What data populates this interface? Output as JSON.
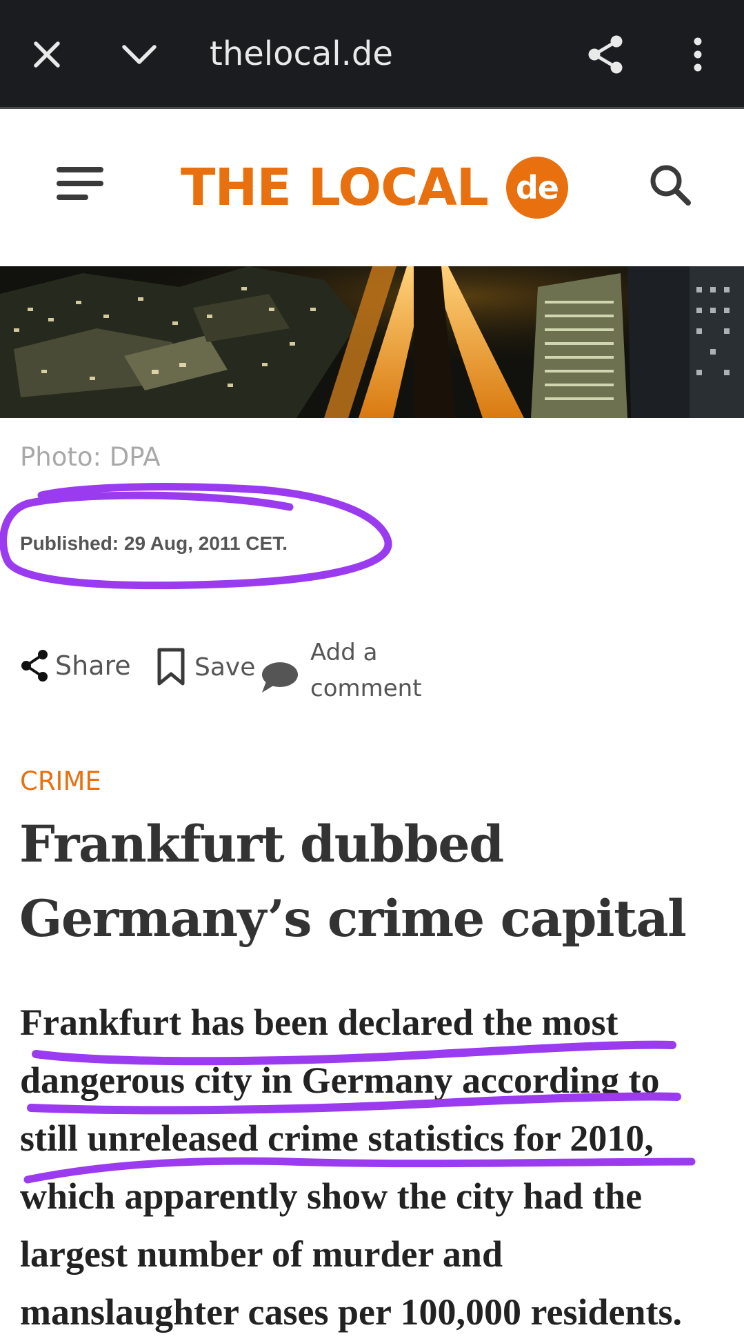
{
  "browser": {
    "url": "thelocal.de",
    "icons": {
      "close": "close-icon",
      "collapse": "chevron-down-icon",
      "share": "share-icon",
      "more": "more-vert-icon"
    }
  },
  "site": {
    "logo_text": "THE LOCAL",
    "logo_badge": "de",
    "brand_color": "#e8700e",
    "icons": {
      "menu": "hamburger-menu-icon",
      "search": "search-icon"
    }
  },
  "article": {
    "photo_credit": "Photo: DPA",
    "published": "Published: 29 Aug, 2011 CET.",
    "actions": {
      "share": "Share",
      "save": "Save",
      "comment_line1": "Add a",
      "comment_line2": "comment"
    },
    "category": "CRIME",
    "headline_line1": "Frankfurt dubbed",
    "headline_line2": "Germany’s crime capital",
    "lead_lines": [
      "Frankfurt has been declared the most",
      "dangerous city in Germany according to",
      "still unreleased crime statistics for 2010,",
      "which apparently show the city had the",
      "largest number of murder and",
      "manslaughter cases per 100,000 residents."
    ]
  },
  "annotation_color": "#9b3bf0"
}
